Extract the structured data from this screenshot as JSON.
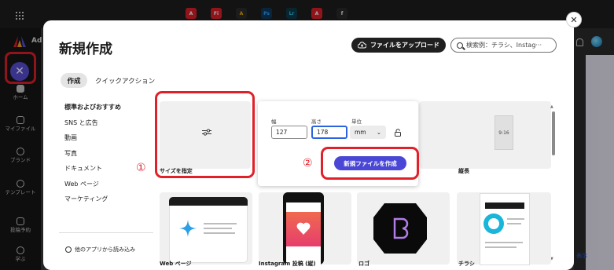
{
  "app": {
    "brand_short": "Ad",
    "app_tiles": [
      {
        "label": "A",
        "color": "#e1202a"
      },
      {
        "label": "Fi",
        "color": "#e1202a"
      },
      {
        "label": "A",
        "color": "#2b2b2b"
      },
      {
        "label": "Ps",
        "color": "#0d3a5e"
      },
      {
        "label": "Lr",
        "color": "#0c3b4a"
      },
      {
        "label": "A",
        "color": "#e1202a"
      },
      {
        "label": "f",
        "color": "#2a2a2a"
      }
    ],
    "nav": [
      "ホーム",
      "マイファイル",
      "ブランド",
      "テンプレート",
      "投稿予約",
      "学ぶ"
    ],
    "right_peek": "表示"
  },
  "modal": {
    "title": "新規作成",
    "upload_label": "ファイルをアップロード",
    "search_placeholder": "検索例：チラシ、Instag···",
    "tabs": [
      "作成",
      "クイックアクション"
    ],
    "categories": [
      "標準およびおすすめ",
      "SNS と広告",
      "動画",
      "写真",
      "ドキュメント",
      "Web ページ",
      "マーケティング"
    ],
    "import_link": "他のアプリから読み込み",
    "cards_row1": {
      "custom_size": "サイズを指定",
      "portrait": "縦長",
      "portrait_ratio": "9:16"
    },
    "cards_row2": [
      "Web ページ",
      "Instagram 投稿 (縦)",
      "ロゴ",
      "チラシ"
    ],
    "custom_form": {
      "width_label": "幅",
      "width_value": "127",
      "height_label": "高さ",
      "height_value": "178",
      "unit_label": "単位",
      "unit_value": "mm",
      "create_button": "新規ファイルを作成"
    }
  },
  "annotations": {
    "step1": "①",
    "step2": "②"
  },
  "colors": {
    "accent": "#4b47d6",
    "annotation_red": "#e1202a",
    "focus_blue": "#2b63e0"
  }
}
